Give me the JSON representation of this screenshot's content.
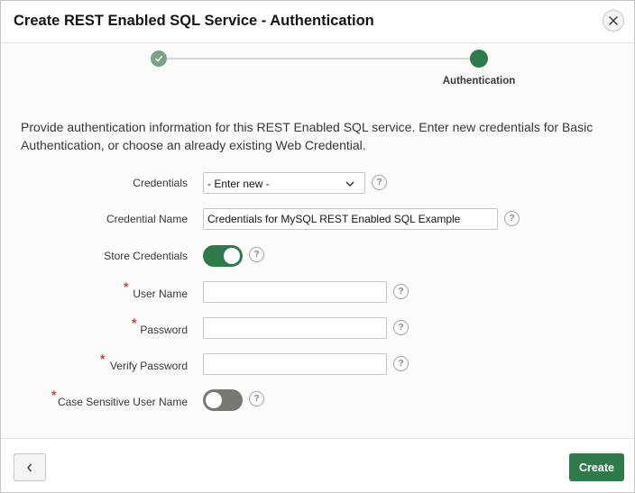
{
  "dialog": {
    "title": "Create REST Enabled SQL Service - Authentication"
  },
  "wizard": {
    "current_step_label": "Authentication"
  },
  "description": "Provide authentication information for this REST Enabled SQL service. Enter new credentials for Basic Authentication, or choose an already existing Web Credential.",
  "form": {
    "credentials": {
      "label": "Credentials",
      "value": "- Enter new -"
    },
    "credential_name": {
      "label": "Credential Name",
      "value": "Credentials for MySQL REST Enabled SQL Example"
    },
    "store_credentials": {
      "label": "Store Credentials",
      "on": true
    },
    "user_name": {
      "label": "User Name",
      "value": ""
    },
    "password": {
      "label": "Password",
      "value": ""
    },
    "verify_password": {
      "label": "Verify Password",
      "value": ""
    },
    "case_sensitive": {
      "label": "Case Sensitive User Name",
      "on": false
    },
    "help_glyph": "?",
    "required_mark": "*"
  },
  "footer": {
    "create_label": "Create"
  },
  "colors": {
    "primary": "#2f7a4a",
    "completed_step": "#7aa285",
    "required": "#c74634"
  },
  "icons": {
    "close": "close-icon",
    "check": "check-icon",
    "chevron": "chevron-down-icon",
    "back": "chevron-left-icon",
    "help": "help-icon"
  }
}
